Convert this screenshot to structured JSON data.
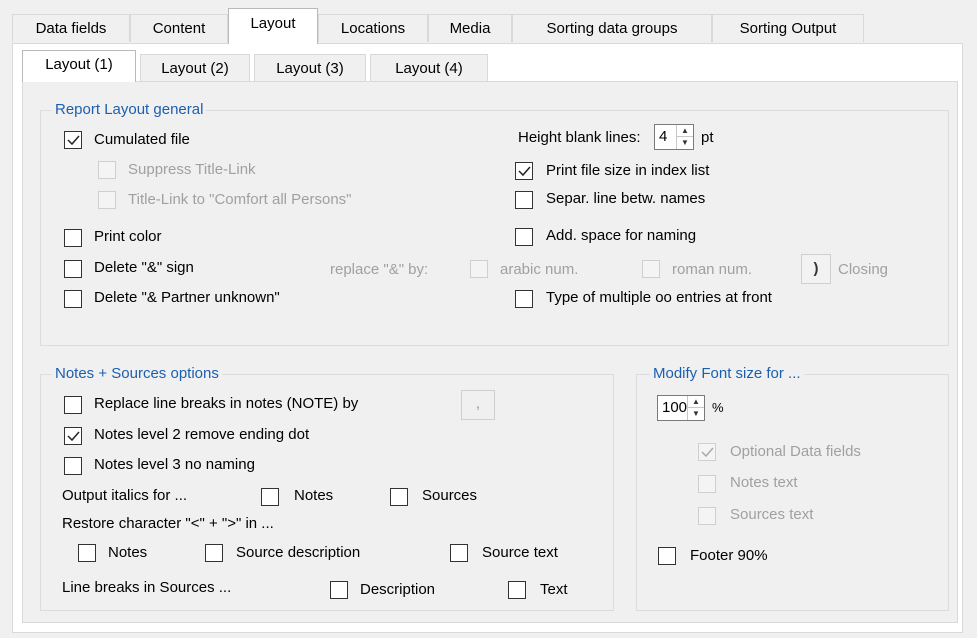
{
  "tabs_top": [
    "Data fields",
    "Content",
    "Layout",
    "Locations",
    "Media",
    "Sorting data groups",
    "Sorting Output"
  ],
  "tabs_layout": [
    "Layout (1)",
    "Layout (2)",
    "Layout (3)",
    "Layout (4)"
  ],
  "general": {
    "title": "Report Layout general",
    "cumulated_file": "Cumulated file",
    "suppress_title_link": "Suppress Title-Link",
    "title_link_comfort": "Title-Link to \"Comfort all Persons\"",
    "print_color": "Print color",
    "delete_amp": "Delete \"&\" sign",
    "delete_amp_partner": "Delete \"& Partner unknown\"",
    "height_blank_lines_label": "Height blank lines:",
    "height_blank_lines_value": "4",
    "height_blank_lines_unit": "pt",
    "print_file_size": "Print file size in index list",
    "separ_line": "Separ. line betw. names",
    "add_space": "Add. space for naming",
    "replace_amp_by": "replace \"&\" by:",
    "arabic_num": "arabic num.",
    "roman_num": "roman num.",
    "closing_char": ")",
    "closing": "Closing",
    "multiple_oo": "Type of multiple oo entries at front"
  },
  "notes": {
    "title": "Notes + Sources options",
    "replace_line_breaks": "Replace line breaks in notes (NOTE) by",
    "replace_char": ",",
    "notes_level2": "Notes level 2 remove ending dot",
    "notes_level3": "Notes level 3 no naming",
    "output_italics": "Output italics for ...",
    "italics_notes": "Notes",
    "italics_sources": "Sources",
    "restore_char": "Restore character \"<\" + \">\" in ...",
    "restore_notes": "Notes",
    "restore_source_desc": "Source description",
    "restore_source_text": "Source text",
    "line_breaks_sources": "Line breaks in Sources ...",
    "lb_description": "Description",
    "lb_text": "Text"
  },
  "font": {
    "title": "Modify Font size for ...",
    "value": "100",
    "unit": "%",
    "optional_data_fields": "Optional Data fields",
    "notes_text": "Notes text",
    "sources_text": "Sources text",
    "footer": "Footer 90%"
  }
}
